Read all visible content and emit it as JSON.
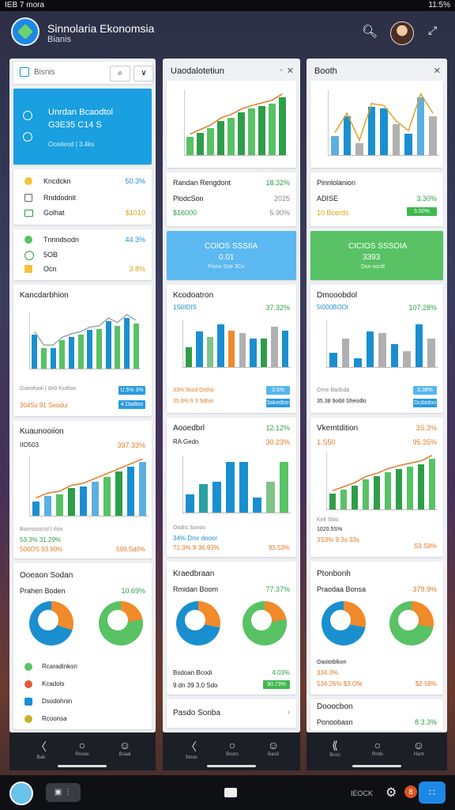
{
  "status": {
    "left": "IEB 7 mora",
    "right": "11:5%"
  },
  "app": {
    "title": "Sinnolaria Ekonomsia",
    "subtitle": "Bianis"
  },
  "icons": [
    "search-icon",
    "avatar",
    "expand-icon"
  ],
  "panel1": {
    "search_label": "Bisnis",
    "blue_card": {
      "l1": "Unrdan Bcaodtol",
      "l2": "G3E35 C14 S",
      "l3": "Ocedeod | 3.4ks"
    },
    "rows": [
      {
        "label": "Kncdckn",
        "value": "50.3%"
      },
      {
        "label": "Rnddodnit",
        "value": ""
      },
      {
        "label": "Golhat",
        "value": "$1010"
      }
    ],
    "rows2": [
      {
        "label": "Tnnndsodn",
        "value": "44.3%"
      },
      {
        "label": "5OB",
        "value": ""
      },
      {
        "label": "Ocn",
        "value": "3 8%"
      }
    ],
    "chart1": {
      "title": "Kancdarbhion",
      "foot1": "Gueofooli | dn0 fcutlow",
      "foot2": "304Ss  91 Seodui",
      "btn1": "U.5% 3%",
      "btn2": "4 Dadtos"
    },
    "chart2": {
      "title": "Kuaunooiion",
      "subtitle": "IIO503",
      "value": "397.33%",
      "foot1": "Bonrssocrol | rlon",
      "foot2": "53.3%  31.29%",
      "foot3": "500OS  93.90%",
      "foot4": "599.Sd0%"
    },
    "donuts": {
      "title": "Ooeaon Sodan",
      "sub": "Prahen Boden",
      "value": "10.69%"
    },
    "list": [
      "Rcaradinkon",
      "Kcadols",
      "Dsodohnin",
      "Rcoonsa"
    ]
  },
  "panel2": {
    "title": "Uaodalotetiun",
    "rows": [
      {
        "label": "Randan Rengdont",
        "value": "18.32%"
      },
      {
        "label": "PlodcSon",
        "value": "2025"
      },
      {
        "label": "$16000",
        "value": "5.90%"
      }
    ],
    "blue": {
      "l1": "COIOS SSSIIA",
      "l2": "0.01",
      "l3": "Pisnn Sstr 3Cn"
    },
    "chart1": {
      "title": "Kcodoatron",
      "sub": "1S0IDIS",
      "value": "37.32%",
      "foot1": "33%  9osd Ostho",
      "foot2": "35.8%  9 3 Sdhin",
      "btn1": "3.5%",
      "btn2": "Sakedton"
    },
    "chart2": {
      "title": "Aooedbrl",
      "value": "12.12%",
      "sub": "RA Gedn",
      "value2": "30.23%",
      "foot1": "Oodrs Sonos",
      "foot2": "34%  Dmr dooor",
      "foot3": "71.3%  9 36.93%",
      "foot4": "93.53%"
    },
    "donut": {
      "title": "Kraedbraan",
      "sub": "Rmidan Boom",
      "value": "77.37%",
      "foot1": "Bsdoan Bcodi",
      "foot2": "4.03%",
      "foot3": "9 dn 39 3.0 Sdo",
      "btn": "90.73%"
    },
    "last": "Pasdo Sonba"
  },
  "panel3": {
    "title": "Booth",
    "rows": [
      {
        "label": "Pinnlolanion",
        "value": ""
      },
      {
        "label": "ADISE",
        "value": "3.30%"
      },
      {
        "label": "10 Bcerds",
        "value": ""
      }
    ],
    "btn1": "5.50%",
    "green": {
      "l1": "CICIOS SSSOIA",
      "l2": "3393",
      "l3": "Dsn oordl"
    },
    "chart1": {
      "title": "Dmooobdol",
      "sub": "5I000BOOI",
      "value": "107.28%",
      "foot1": "Orne Badsda",
      "foot2": "35.38  9o68 Sheodlo",
      "btn1": "3.38%",
      "btn2": "Dcdadoo"
    },
    "chart2": {
      "title": "Vkemtdition",
      "value": "3S.3%",
      "sub": "1.S50",
      "value2": "95.35%",
      "foot1": "Kell Stiio",
      "foot2": "1020.5S%",
      "foot3": "3S3%  9 3s 33s",
      "foot4": "S3.S8%"
    },
    "donut": {
      "title": "Ptonbonh",
      "sub": "Praodaa Bonsa",
      "value": "379.9%",
      "foot1": "Oaolotblkon",
      "foot2": "334.3%",
      "foot3": "534.26%  $3.Ofe",
      "btn": "$2.58%"
    },
    "last": "Dooocbon",
    "last2": "Ponoobasn",
    "last2v": "8 3.3%"
  },
  "nav": {
    "back": "Bab",
    "home": "Rnoas",
    "user": "Bsaal",
    "btn2": "Stnos",
    "home2": "Boors",
    "user2": "Basd",
    "back3": "Bcco",
    "home3": "Rnds",
    "user3": "Hant"
  },
  "dock": {
    "label": "IEOCK"
  },
  "chart_data": [
    {
      "type": "bar",
      "series": [
        {
          "name": "blue",
          "values": [
            30,
            18,
            28,
            34,
            42,
            45,
            52,
            58,
            60
          ]
        },
        {
          "name": "green",
          "values": [
            18,
            25,
            30,
            35,
            38,
            40,
            46,
            48,
            62
          ]
        }
      ]
    },
    {
      "type": "bar",
      "values": [
        15,
        20,
        22,
        28,
        30,
        35,
        40,
        45,
        50,
        55,
        58,
        62
      ]
    },
    {
      "type": "bar",
      "values": [
        20,
        35,
        30,
        42,
        36,
        34,
        28,
        28,
        40,
        36
      ]
    },
    {
      "type": "bar",
      "values": [
        18,
        28,
        30,
        50,
        50,
        15,
        30,
        50
      ]
    },
    {
      "type": "bar",
      "values": [
        20,
        40,
        12,
        50,
        48,
        32,
        22,
        60,
        40
      ]
    },
    {
      "type": "bar",
      "values": [
        20,
        25,
        30,
        38,
        42,
        48,
        52,
        55,
        58,
        65
      ]
    }
  ]
}
